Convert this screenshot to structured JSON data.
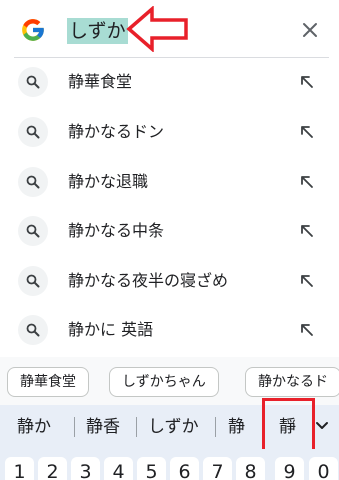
{
  "search": {
    "query": "しずか",
    "clear_icon": "close-icon",
    "logo": "google-g-logo"
  },
  "annotation_arrow_color": "#e8202a",
  "suggestions": [
    {
      "text": "静華食堂"
    },
    {
      "text": "静かなるドン"
    },
    {
      "text": "静かな退職"
    },
    {
      "text": "静かなる中条"
    },
    {
      "text": "静かなる夜半の寝ざめ"
    },
    {
      "text": "静かに 英語"
    }
  ],
  "chips": [
    "静華食堂",
    "しずかちゃん",
    "静かなるド"
  ],
  "candidates": [
    "静か",
    "静香",
    "しずか",
    "静",
    "靜"
  ],
  "number_keys": [
    "1",
    "2",
    "3",
    "4",
    "5",
    "6",
    "7",
    "8",
    "9",
    "0"
  ],
  "colors": {
    "highlight": "#a8dcd3",
    "candidate_bar": "#e8eef7",
    "annotation": "#e8202a"
  }
}
